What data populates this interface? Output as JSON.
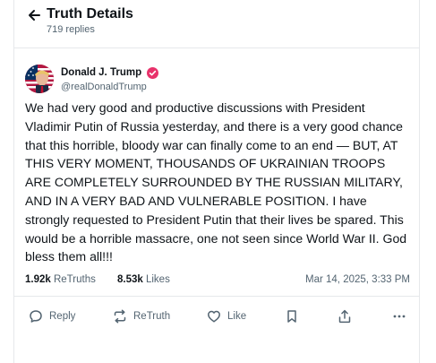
{
  "header": {
    "title": "Truth Details",
    "replies_count": "719 replies"
  },
  "post": {
    "author_name": "Donald J. Trump",
    "author_handle": "@realDonaldTrump",
    "text": "We had very good and productive discussions with President Vladimir Putin of Russia yesterday, and there is a very good chance that this horrible, bloody war can finally come to an end — BUT, AT THIS VERY MOMENT, THOUSANDS OF UKRAINIAN TROOPS ARE COMPLETELY SURROUNDED BY THE RUSSIAN MILITARY, AND IN A VERY BAD AND VULNERABLE POSITION. I have strongly requested to President Putin that their lives be spared. This would be a horrible massacre, one not seen since World War II. God bless them all!!!",
    "retruths_count": "1.92k",
    "retruths_label": "ReTruths",
    "likes_count": "8.53k",
    "likes_label": "Likes",
    "timestamp": "Mar 14, 2025, 3:33 PM"
  },
  "actions": {
    "reply_label": "Reply",
    "retruth_label": "ReTruth",
    "like_label": "Like"
  },
  "icons": {
    "back": "arrow-left-icon",
    "verified": "verified-badge-icon",
    "reply": "speech-bubble-icon",
    "retruth": "retruth-arrows-icon",
    "like": "heart-icon",
    "bookmark": "bookmark-icon",
    "share": "share-upload-icon",
    "more": "ellipsis-icon"
  },
  "colors": {
    "verified_badge": "#e8326b",
    "secondary_text": "#536471",
    "primary_text": "#0f1419",
    "divider": "#e6e8eb"
  }
}
